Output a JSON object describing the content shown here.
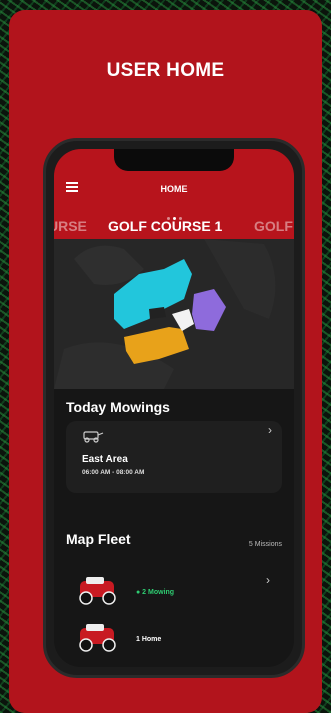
{
  "card": {
    "title": "USER HOME"
  },
  "app": {
    "header_title": "HOME",
    "tabs": {
      "prev": "URSE",
      "active": "GOLF COURSE 1",
      "next": "GOLF"
    },
    "today": {
      "title": "Today Mowings",
      "area": "East Area",
      "time": "06:00 AM - 08:00 AM"
    },
    "fleet": {
      "title": "Map Fleet",
      "count": "5 Missions",
      "robots": [
        {
          "status": "● 2 Mowing",
          "color": "#2ecc71"
        },
        {
          "status": "1 Home",
          "color": "#ffffff"
        }
      ]
    }
  },
  "colors": {
    "brand_red": "#b2141c",
    "mowing_green": "#2ecc71"
  }
}
